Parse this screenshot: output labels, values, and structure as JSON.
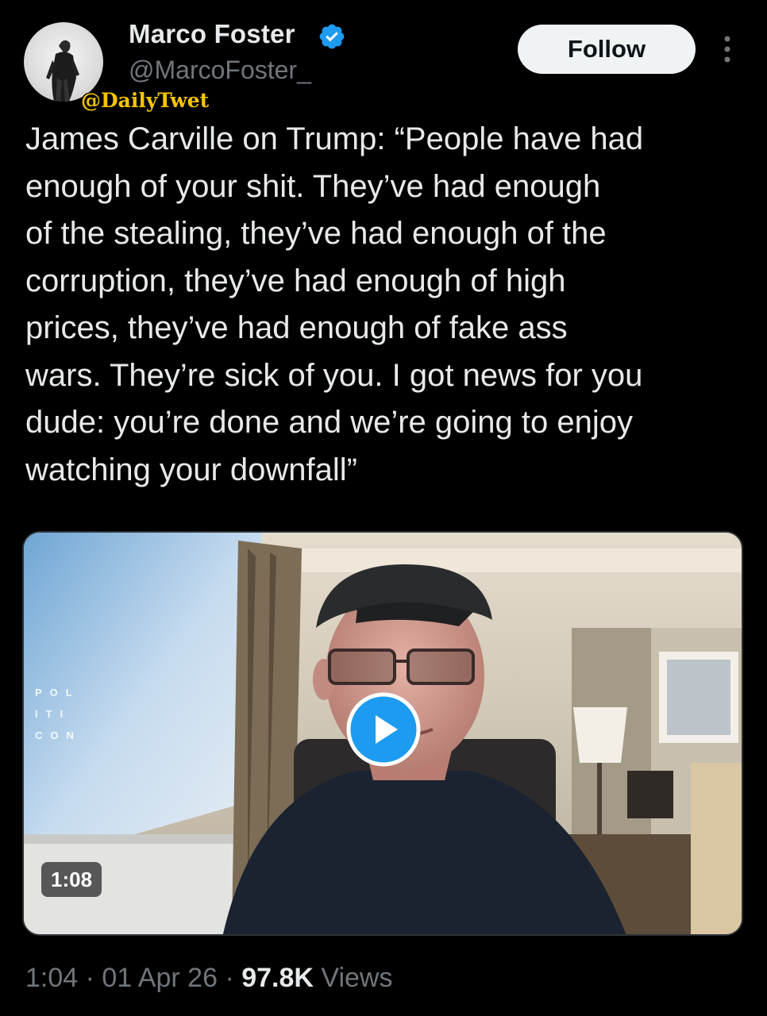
{
  "author": {
    "display_name": "Marco Foster",
    "handle": "@MarcoFoster_",
    "verified": true
  },
  "watermark": "@DailyTwet",
  "follow_label": "Follow",
  "tweet": {
    "text": "James Carville on Trump: “People have had\nenough of your shit. They’ve had enough\nof the stealing, they’ve had enough of the\ncorruption, they’ve had enough of high\nprices, they’ve had enough of fake ass\nwars. They’re sick of you. I got news for you\ndude: you’re done and we’re going to enjoy\nwatching your downfall”"
  },
  "media": {
    "duration": "1:08",
    "brand_text": "POL ITI CON",
    "play_icon": "play-icon"
  },
  "meta": {
    "time": "1:04",
    "separator": "·",
    "date": "01 Apr 26",
    "views_count": "97.8K",
    "views_label": "Views"
  },
  "colors": {
    "background": "#000000",
    "text": "#e7e9ea",
    "muted": "#71767b",
    "accent": "#1d9bf0",
    "watermark": "#f5c400"
  }
}
